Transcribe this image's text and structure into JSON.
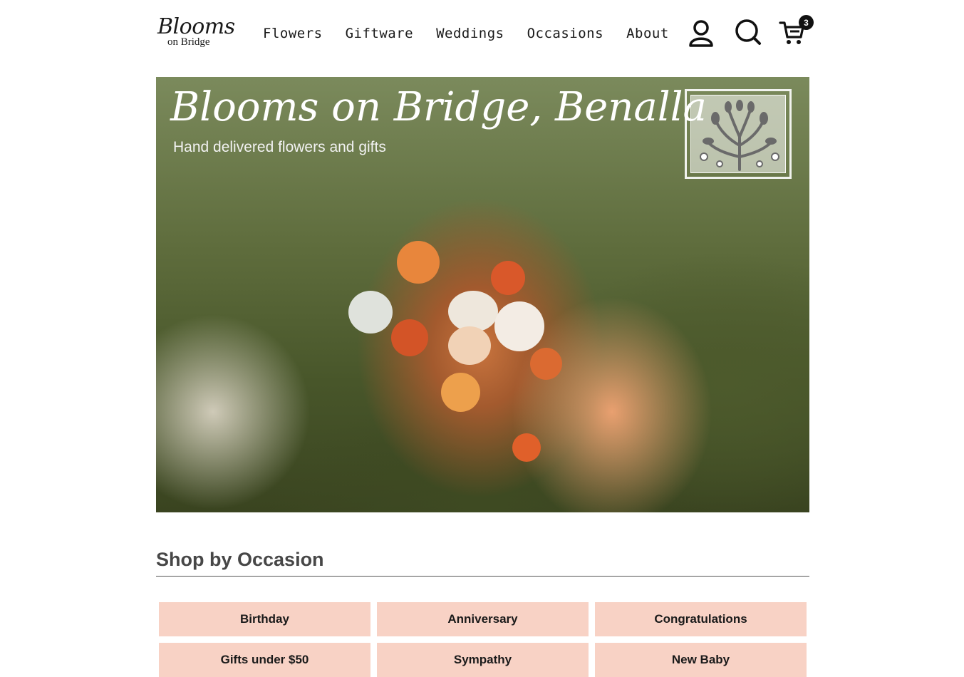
{
  "header": {
    "logo_main": "Blooms",
    "logo_sub": "on Bridge",
    "nav": [
      "Flowers",
      "Giftware",
      "Weddings",
      "Occasions",
      "About"
    ],
    "cart_count": "3"
  },
  "hero": {
    "title": "Blooms on Bridge, Benalla",
    "subtitle": "Hand delivered flowers and gifts"
  },
  "section": {
    "title": "Shop by Occasion",
    "occasions": [
      "Birthday",
      "Anniversary",
      "Congratulations",
      "Gifts under $50",
      "Sympathy",
      "New Baby"
    ]
  },
  "colors": {
    "tile_bg": "#f8d2c5",
    "heading": "#474747",
    "badge": "#111111"
  },
  "icons": [
    "user-icon",
    "search-icon",
    "cart-icon",
    "tree-emblem-icon"
  ]
}
